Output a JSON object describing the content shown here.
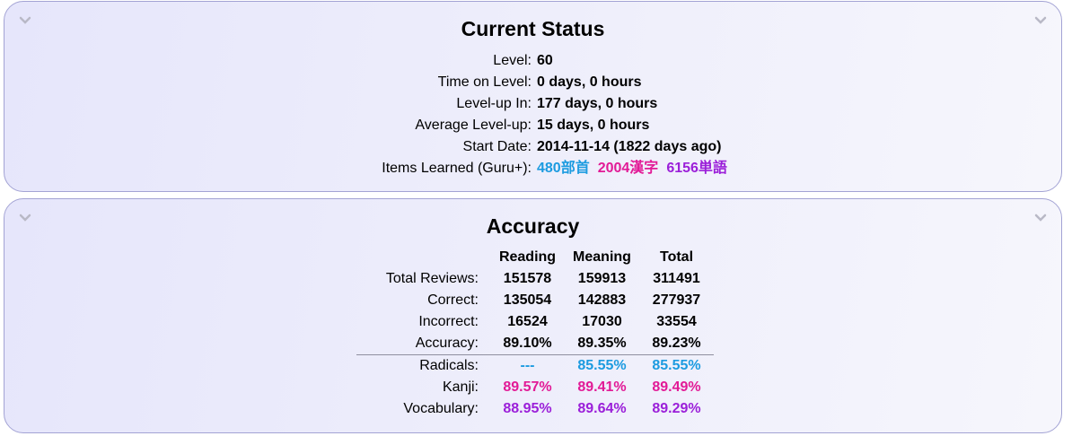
{
  "status": {
    "title": "Current Status",
    "rows": [
      {
        "label": "Level:",
        "value": "60"
      },
      {
        "label": "Time on Level:",
        "value": "0 days, 0 hours"
      },
      {
        "label": "Level-up In:",
        "value": "177 days, 0 hours"
      },
      {
        "label": "Average Level-up:",
        "value": "15 days, 0 hours"
      },
      {
        "label": "Start Date:",
        "value": "2014-11-14 (1822 days ago)"
      }
    ],
    "items_learned": {
      "label": "Items Learned (Guru+):",
      "radicals": "480部首",
      "kanji": "2004漢字",
      "vocab": "6156単語"
    }
  },
  "accuracy": {
    "title": "Accuracy",
    "headers": [
      "Reading",
      "Meaning",
      "Total"
    ],
    "rows": [
      {
        "label": "Total Reviews:",
        "values": [
          "151578",
          "159913",
          "311491"
        ]
      },
      {
        "label": "Correct:",
        "values": [
          "135054",
          "142883",
          "277937"
        ]
      },
      {
        "label": "Incorrect:",
        "values": [
          "16524",
          "17030",
          "33554"
        ]
      },
      {
        "label": "Accuracy:",
        "values": [
          "89.10%",
          "89.35%",
          "89.23%"
        ]
      },
      {
        "label": "Radicals:",
        "values": [
          "---",
          "85.55%",
          "85.55%"
        ]
      },
      {
        "label": "Kanji:",
        "values": [
          "89.57%",
          "89.41%",
          "89.49%"
        ]
      },
      {
        "label": "Vocabulary:",
        "values": [
          "88.95%",
          "89.64%",
          "89.29%"
        ]
      }
    ]
  },
  "colors": {
    "radicals": "#1c9be0",
    "kanji": "#e21a96",
    "vocabulary": "#9b1fd9",
    "panel_border": "#a3a3d4"
  },
  "icons": {
    "collapse": "chevron-down-icon"
  }
}
